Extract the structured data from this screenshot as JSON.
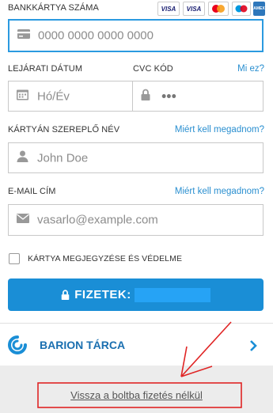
{
  "card_number": {
    "label": "BANKKÁRTYA SZÁMA",
    "placeholder": "0000 0000 0000 0000",
    "logos": [
      "VISA",
      "VISA",
      "mastercard",
      "maestro",
      "AMEX"
    ]
  },
  "expiry": {
    "label": "LEJÁRATI DÁTUM",
    "placeholder": "Hó/Év"
  },
  "cvc": {
    "label": "CVC KÓD",
    "help": "Mi ez?",
    "placeholder": "•••"
  },
  "cardholder": {
    "label": "KÁRTYÁN SZEREPLŐ NÉV",
    "help": "Miért kell megadnom?",
    "placeholder": "John Doe"
  },
  "email": {
    "label": "E-MAIL CÍM",
    "help": "Miért kell megadnom?",
    "placeholder": "vasarlo@example.com"
  },
  "remember": {
    "label": "KÁRTYA MEGJEGYZÉSE ÉS VÉDELME",
    "checked": false
  },
  "pay_button": {
    "label": "FIZETEK:"
  },
  "wallet": {
    "label": "BARION TÁRCA"
  },
  "footer": {
    "back_link": "Vissza a boltba fizetés nélkül"
  },
  "colors": {
    "accent": "#1a8ed6",
    "focus_border": "#2b9ae0",
    "annotation": "#e02424"
  }
}
